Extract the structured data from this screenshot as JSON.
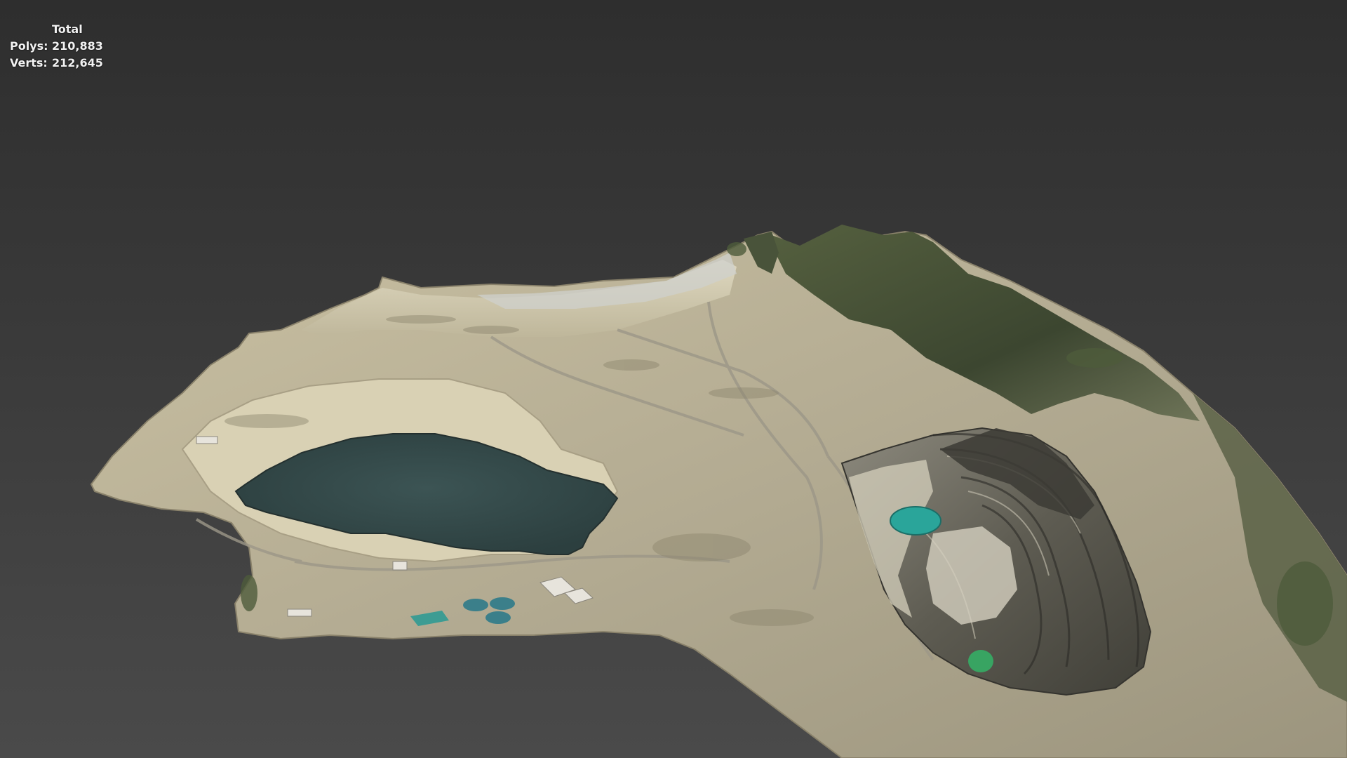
{
  "viewport": {
    "name": "3D perspective viewport",
    "background_top": "#2e2e2e",
    "background_bottom": "#4a4a4a"
  },
  "stats": {
    "title": "Total",
    "polys_label": "Polys:",
    "polys_value": "210,883",
    "verts_label": "Verts:",
    "verts_value": "212,645"
  },
  "model": {
    "subject": "open-pit mine terrain mesh",
    "colors": {
      "terrain": "#b9b096",
      "rock_light": "#d6cfb6",
      "rock_dark": "#4b4a42",
      "vegetation": "#3f4a32",
      "lake": "#34494a",
      "pool_teal": "#2aa59a",
      "pool_green": "#38a462"
    }
  }
}
